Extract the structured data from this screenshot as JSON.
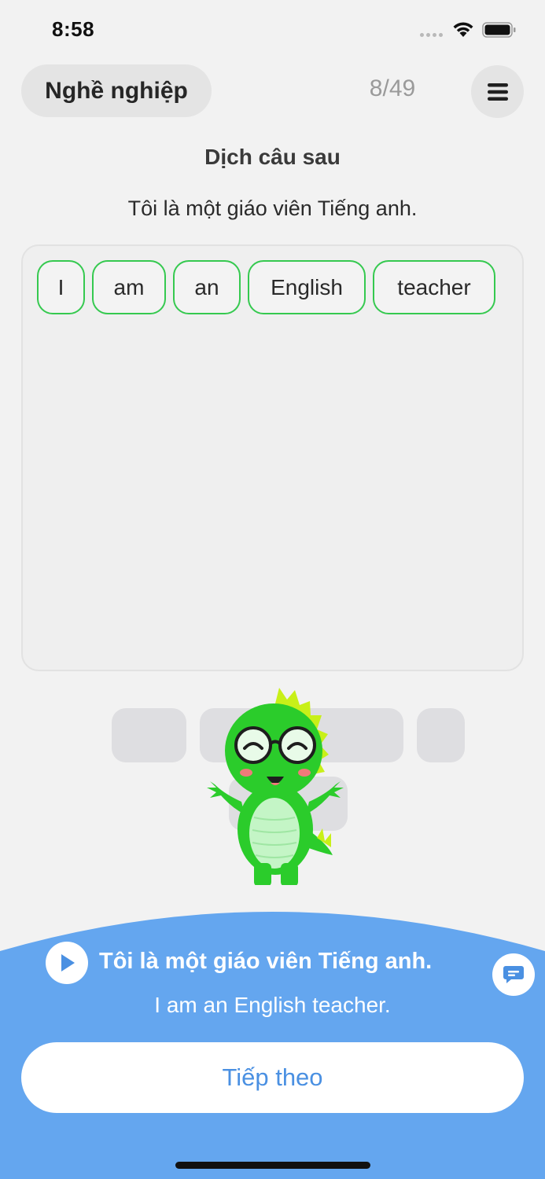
{
  "status_bar": {
    "time": "8:58"
  },
  "header": {
    "topic": "Nghề nghiệp",
    "progress": "8/49",
    "menu_icon": "hamburger-menu-icon"
  },
  "exercise": {
    "instruction": "Dịch câu sau",
    "prompt": "Tôi là một giáo viên Tiếng anh.",
    "selected_words": [
      "I",
      "am",
      "an",
      "English",
      "teacher"
    ]
  },
  "feedback": {
    "vietnamese": "Tôi là một giáo viên Tiếng anh.",
    "english": "I am an English teacher.",
    "play_icon": "play-icon",
    "comment_icon": "chat-bubble-icon",
    "next_label": "Tiếp theo"
  },
  "colors": {
    "accent_green": "#35c94f",
    "panel_blue": "#64a6ef",
    "next_text_blue": "#4a90e2"
  }
}
